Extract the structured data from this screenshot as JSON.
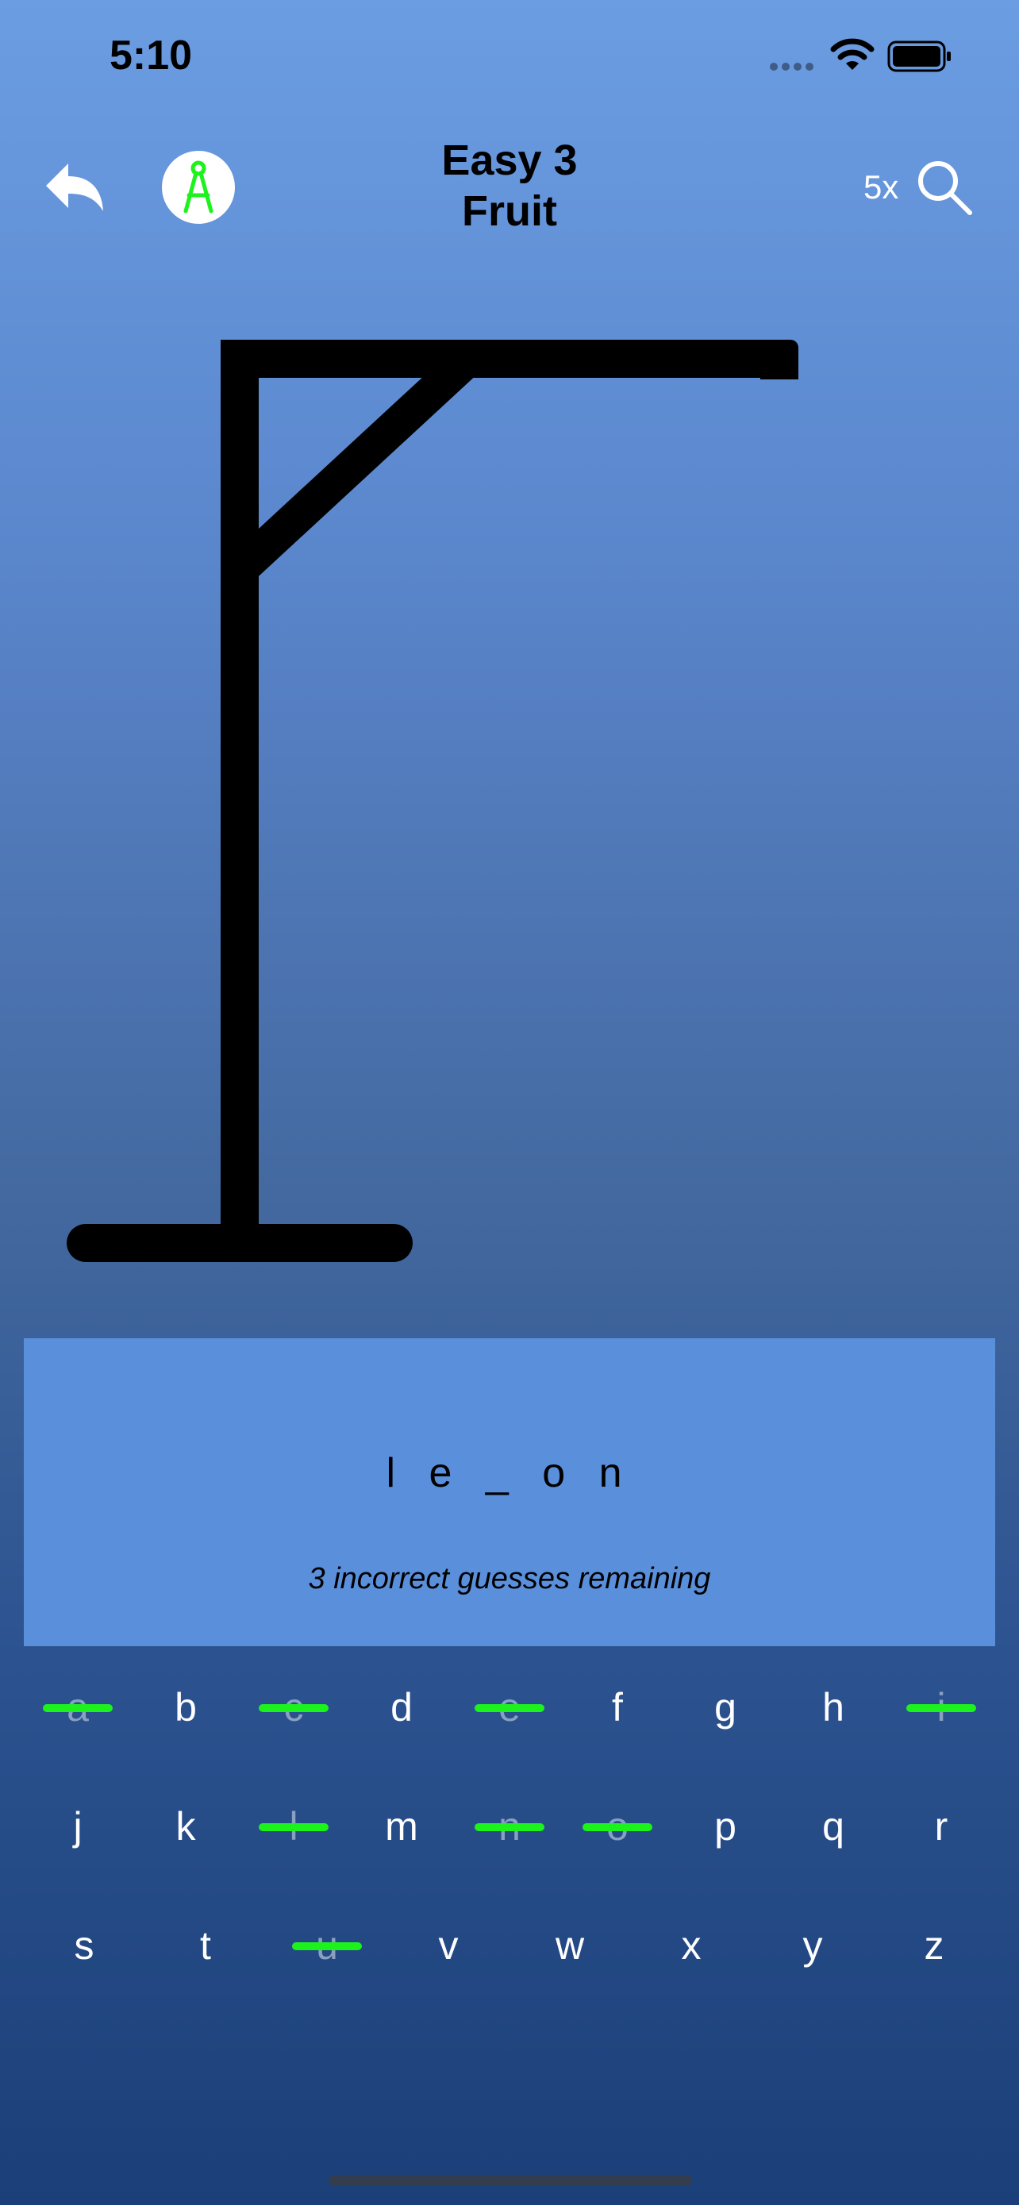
{
  "status_bar": {
    "time": "5:10"
  },
  "nav": {
    "title_line1": "Easy 3",
    "title_line2": "Fruit",
    "zoom": "5x",
    "icons": {
      "back": "back-arrow-icon",
      "compass": "compass-icon",
      "zoom": "magnifier-icon"
    },
    "compass_color": "#1cf21c"
  },
  "puzzle": {
    "word": "l e _ o n",
    "remaining": "3 incorrect guesses remaining"
  },
  "keyboard": {
    "row1": [
      {
        "letter": "a",
        "used": true
      },
      {
        "letter": "b",
        "used": false
      },
      {
        "letter": "c",
        "used": true
      },
      {
        "letter": "d",
        "used": false
      },
      {
        "letter": "e",
        "used": true
      },
      {
        "letter": "f",
        "used": false
      },
      {
        "letter": "g",
        "used": false
      },
      {
        "letter": "h",
        "used": false
      },
      {
        "letter": "i",
        "used": true
      }
    ],
    "row2": [
      {
        "letter": "j",
        "used": false
      },
      {
        "letter": "k",
        "used": false
      },
      {
        "letter": "l",
        "used": true
      },
      {
        "letter": "m",
        "used": false
      },
      {
        "letter": "n",
        "used": true
      },
      {
        "letter": "o",
        "used": true
      },
      {
        "letter": "p",
        "used": false
      },
      {
        "letter": "q",
        "used": false
      },
      {
        "letter": "r",
        "used": false
      }
    ],
    "row3": [
      {
        "letter": "s",
        "used": false
      },
      {
        "letter": "t",
        "used": false
      },
      {
        "letter": "u",
        "used": true
      },
      {
        "letter": "v",
        "used": false
      },
      {
        "letter": "w",
        "used": false
      },
      {
        "letter": "x",
        "used": false
      },
      {
        "letter": "y",
        "used": false
      },
      {
        "letter": "z",
        "used": false
      }
    ],
    "strike_color": "#1cf21c"
  }
}
